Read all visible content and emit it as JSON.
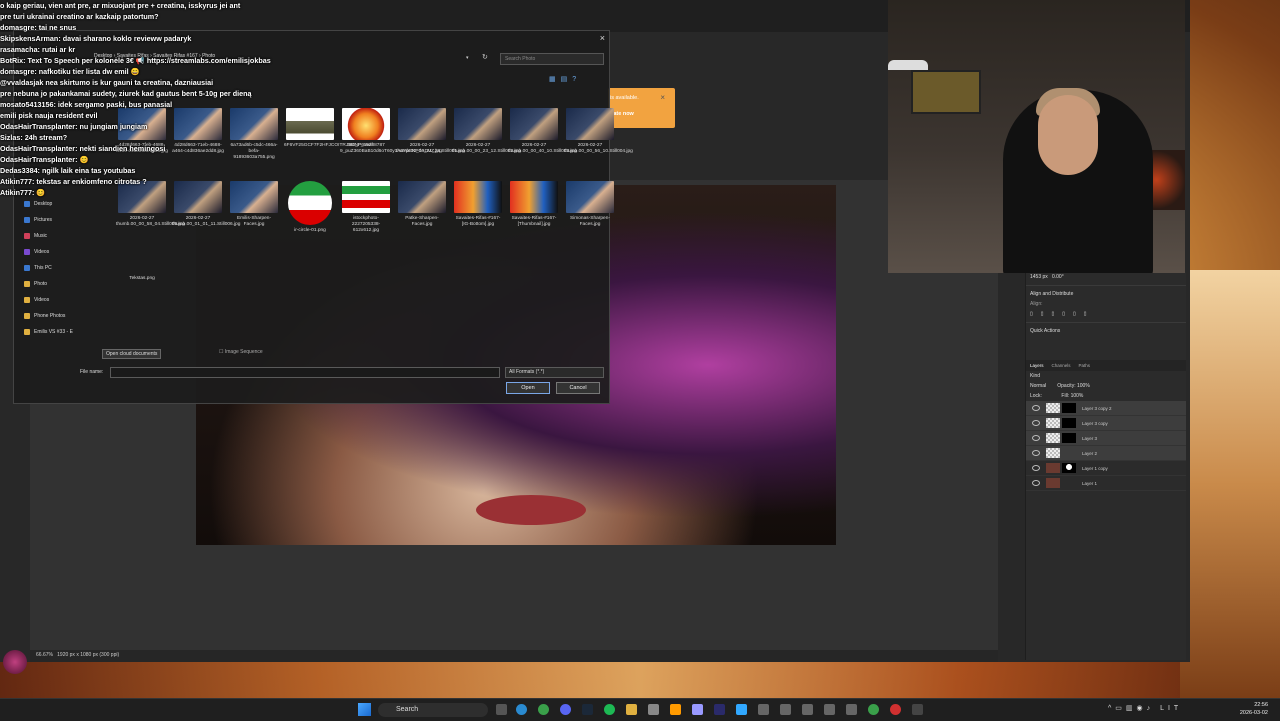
{
  "chat": [
    {
      "text": "o kaip geriau, vien ant pre, ar mixuojant pre + creatina, isskyrus jei ant"
    },
    {
      "text": "pre turi ukrainai creatino ar kazkaip patortum?"
    },
    {
      "text": "domasgre: tai ne snus"
    },
    {
      "text": "SkipskensArman: davai sharano koklo revieww padaryk"
    },
    {
      "text": "rasamacha: rutai ar kr"
    },
    {
      "text": "BotRix: Text To Speech per kolonėlė 3€ 📢 https://streamlabs.com/emilisjokbas"
    },
    {
      "text": "domasgre: nafkotiku tier lista dw emil 😄"
    },
    {
      "text": "@vvaldasjak nea skirtumo is kur gauni ta creatina, dazniausiai"
    },
    {
      "text": "pre nebuna jo pakankamai sudety, ziurek kad gautus bent 5-10g per dieną"
    },
    {
      "text": "mosato5413156: idek sergamo paski, bus panasial"
    },
    {
      "text": "emili pisk nauja resident evil"
    },
    {
      "text": "OdasHairTransplanter: nu jungiam jungiam"
    },
    {
      "text": "Sizlas: 24h stream?"
    },
    {
      "text": "OdasHairTransplanter: nekti siandien hemingosi"
    },
    {
      "text": "OdasHairTransplanter: 😊"
    },
    {
      "text": "Dedas3384: ngilk laik eina tas youtubas"
    },
    {
      "text": "Atikin777: tekstas ar enkiomfeno citrotas ?"
    },
    {
      "text": "Atikin777: 😊"
    }
  ],
  "dialog": {
    "breadcrumb": "Desktop › Savaites Rifas › Savaites Rifas #167 › Photo",
    "search_placeholder": "Search Photo",
    "close_label": "×",
    "nav": [
      {
        "label": "Desktop",
        "color": "#3a78d0"
      },
      {
        "label": "Pictures",
        "color": "#3a78d0"
      },
      {
        "label": "Music",
        "color": "#d0405a"
      },
      {
        "label": "Videos",
        "color": "#7a4ad0"
      },
      {
        "label": "This PC",
        "color": "#3a78d0"
      },
      {
        "label": "Photo",
        "color": "#e0b040"
      },
      {
        "label": "Videos",
        "color": "#e0b040"
      },
      {
        "label": "Phone Photos",
        "color": "#e0b040"
      },
      {
        "label": "Emilis VS #33 - E",
        "color": "#e0b040"
      }
    ],
    "files_row1": [
      {
        "name": "4d28d663-7feb-4688-a464-c4d836ae2dd8.jpg",
        "thumb": "face"
      },
      {
        "name": "4d28d663-71eb-4688-a464-c4d836ae2dd8.jpg",
        "thumb": "face"
      },
      {
        "name": "6a73ad6b-c5dc-466a-befa-91893603a755.png",
        "thumb": "face"
      },
      {
        "name": "6F6VF25GCF7F2HFJCOITRJ5GNP6.avif",
        "thumb": "tank"
      },
      {
        "name": "360_F_55288787 9_puZ360BaB10d6oT60y1A6YpENPdADVZ.jpg",
        "thumb": "fire"
      },
      {
        "name": "2026-02-27 thumb.00_00_21_24.Still001.jpg",
        "thumb": "dark"
      },
      {
        "name": "2026-02-27 thumb.00_00_23_12.Still002.jpg",
        "thumb": "dark"
      },
      {
        "name": "2026-02-27 thumb.00_00_40_10.Still003.jpg",
        "thumb": "dark"
      },
      {
        "name": "2026-02-27 thumb.00_00_56_10.Still004.jpg",
        "thumb": "dark"
      }
    ],
    "files_row2": [
      {
        "name": "2026-02-27 thumb.00_00_58_04.Still005.jpg",
        "thumb": "dark"
      },
      {
        "name": "2026-02-27 thumb.00_01_01_11.Still006.jpg",
        "thumb": "dark"
      },
      {
        "name": "Emilis-Sharpen-Faces.jpg",
        "thumb": "face"
      },
      {
        "name": "ir-circle-01.png",
        "thumb": "iranflag"
      },
      {
        "name": "istockphoto-2227205338-612x612.jpg",
        "thumb": "flag2"
      },
      {
        "name": "Patke-Sharpen-Faces.jpg",
        "thumb": "dark"
      },
      {
        "name": "Savaites-Rifas-#167-[IG-Bottom].jpg",
        "thumb": "thumbcol"
      },
      {
        "name": "Savaites-Rifas-#167-[Thumbnail].jpg",
        "thumb": "thumbcol"
      },
      {
        "name": "Simonas-Sharpen-Faces.jpg",
        "thumb": "face"
      }
    ],
    "files_row3": [
      {
        "name": "Tekstas.png",
        "thumb": "blank"
      }
    ],
    "open_cloud": "Open cloud documents",
    "image_sequence": "Image Sequence",
    "file_name_label": "File name:",
    "file_name_value": "",
    "format": "All Formats (*.*)",
    "open_btn": "Open",
    "cancel_btn": "Cancel"
  },
  "toast": {
    "line1": "is available.",
    "line2": "date now"
  },
  "photoshop": {
    "zoom": "66.67%",
    "doc_info": "1920 px x 1080 px (300 ppi)",
    "align_title": "Align and Distribute",
    "align_sub": "Align:",
    "quick_actions": "Quick Actions",
    "width_field": "1453 px",
    "height_field": "0.00°",
    "layer_tabs": [
      "Layers",
      "Channels",
      "Paths"
    ],
    "kind": "Kind",
    "blend": "Normal",
    "opacity": "Opacity: 100%",
    "lock": "Lock:",
    "fill": "Fill: 100%",
    "layers": [
      {
        "name": "Layer 3 copy 2",
        "mask": "black",
        "sel": true
      },
      {
        "name": "Layer 3 copy",
        "mask": "black",
        "sel": true
      },
      {
        "name": "Layer 3",
        "mask": "black",
        "sel": true
      },
      {
        "name": "Layer 2",
        "mask": "none",
        "sel": true
      },
      {
        "name": "Layer 1 copy",
        "mask": "face",
        "sel": false
      },
      {
        "name": "Layer 1",
        "mask": "none",
        "sel": false
      }
    ]
  },
  "taskbar": {
    "search": "Search",
    "time": "22:56",
    "date": "2026-03-02",
    "lang": "LIT"
  }
}
